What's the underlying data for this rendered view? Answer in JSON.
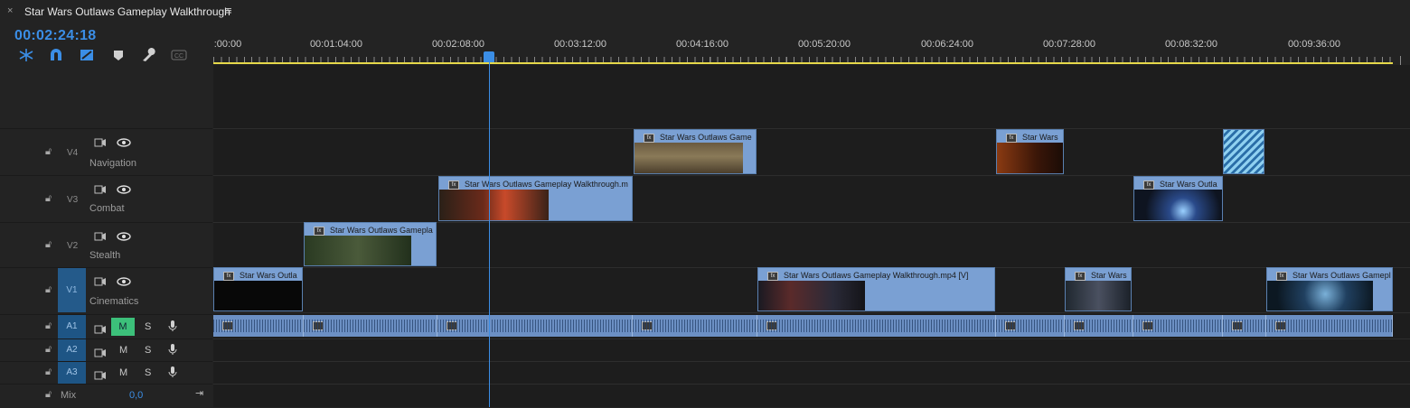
{
  "tab": {
    "close": "×",
    "title": "Star Wars Outlaws Gameplay Walkthrough",
    "menu": "≡"
  },
  "timecode": "00:02:24:18",
  "toolbar_icons": [
    "snap-icon",
    "magnet-icon",
    "linked-selection-icon",
    "marker-icon",
    "wrench-icon",
    "captions-icon"
  ],
  "ruler": {
    "labels": [
      ":00:00",
      "00:01:04:00",
      "00:02:08:00",
      "00:03:12:00",
      "00:04:16:00",
      "00:05:20:00",
      "00:06:24:00",
      "00:07:28:00",
      "00:08:32:00",
      "00:09:36:00"
    ]
  },
  "tracks": {
    "v4": {
      "id": "V4",
      "name": "Navigation"
    },
    "v3": {
      "id": "V3",
      "name": "Combat"
    },
    "v2": {
      "id": "V2",
      "name": "Stealth"
    },
    "v1": {
      "id": "V1",
      "name": "Cinematics"
    },
    "a1": {
      "id": "A1",
      "m": "M",
      "s": "S"
    },
    "a2": {
      "id": "A2",
      "m": "M",
      "s": "S"
    },
    "a3": {
      "id": "A3",
      "m": "M",
      "s": "S"
    },
    "mix": {
      "label": "Mix",
      "value": "0,0"
    }
  },
  "clips": {
    "v4_1": "Star Wars Outlaws Game",
    "v4_2": "Star Wars",
    "v4_3": "",
    "v3_1": "Star Wars Outlaws Gameplay Walkthrough.m",
    "v3_2": "Star Wars Outla",
    "v2_1": "Star Wars Outlaws Gamepla",
    "v1_1": "Star Wars Outla",
    "v1_2": "Star Wars Outlaws Gameplay Walkthrough.mp4 [V]",
    "v1_3": "Star Wars",
    "v1_4": "Star Wars Outlaws Gamepl"
  },
  "colors": {
    "accent": "#3b8ee6",
    "clip": "#7aa0d3",
    "solo_active": "#3cc07a",
    "work_area": "#e6d94a"
  }
}
